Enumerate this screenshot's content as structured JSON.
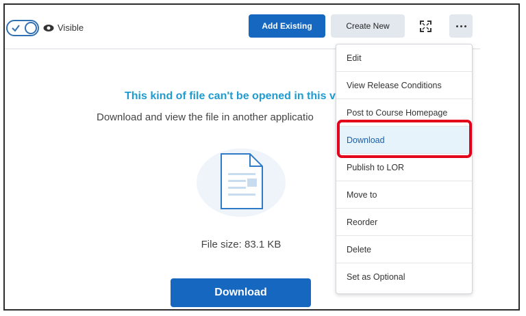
{
  "toolbar": {
    "visibility_label": "Visible",
    "add_existing_label": "Add Existing",
    "create_new_label": "Create New"
  },
  "viewer": {
    "message_title": "This kind of file can't be opened in this vie",
    "message_sub": "Download and view the file in another applicatio",
    "file_size": "File size: 83.1 KB",
    "download_label": "Download"
  },
  "menu": {
    "items": [
      {
        "label": "Edit"
      },
      {
        "label": "View Release Conditions"
      },
      {
        "label": "Post to Course Homepage"
      },
      {
        "label": "Download"
      },
      {
        "label": "Publish to LOR"
      },
      {
        "label": "Move to"
      },
      {
        "label": "Reorder"
      },
      {
        "label": "Delete"
      },
      {
        "label": "Set as Optional"
      }
    ]
  },
  "colors": {
    "primary": "#1567c0",
    "secondary_bg": "#e3e8ee",
    "message_blue": "#1e9bd0",
    "highlight_red": "#e2001a",
    "active_item_bg": "#e6f3fb"
  },
  "icons": [
    "check-icon",
    "eye-icon",
    "expand-icon",
    "more-icon",
    "file-icon"
  ]
}
